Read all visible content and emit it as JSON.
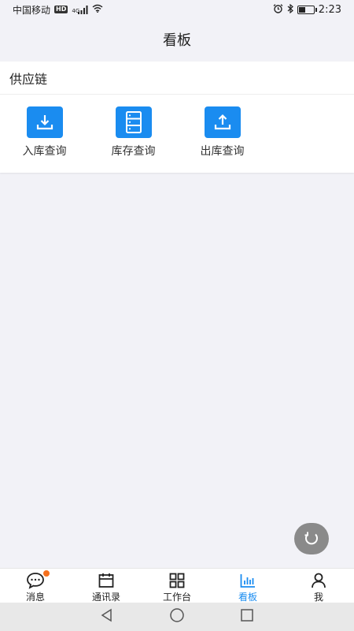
{
  "status_bar": {
    "carrier": "中国移动",
    "hd": "HD",
    "network": "4G",
    "time": "2:23"
  },
  "header": {
    "title": "看板"
  },
  "section": {
    "title": "供应链",
    "tiles": [
      {
        "label": "入库查询",
        "icon": "download-icon"
      },
      {
        "label": "库存查询",
        "icon": "storage-icon"
      },
      {
        "label": "出库查询",
        "icon": "upload-icon"
      }
    ]
  },
  "tabs": [
    {
      "label": "消息",
      "icon": "message-icon",
      "badge": true
    },
    {
      "label": "通讯录",
      "icon": "calendar-icon"
    },
    {
      "label": "工作台",
      "icon": "grid-icon"
    },
    {
      "label": "看板",
      "icon": "bar-chart-icon",
      "active": true
    },
    {
      "label": "我",
      "icon": "user-icon"
    }
  ],
  "colors": {
    "accent": "#1a8cf0",
    "badge": "#f5701e",
    "background": "#f2f2f7",
    "fab": "#8a8a8a"
  }
}
